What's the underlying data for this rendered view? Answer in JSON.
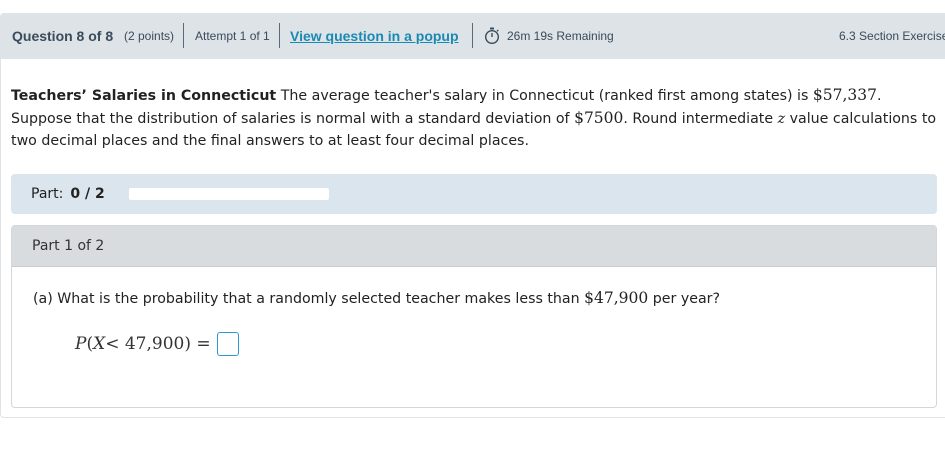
{
  "header": {
    "question": "Question 8 of 8",
    "points": "(2 points)",
    "attempt": "Attempt 1 of 1",
    "popup_link": "View question in a popup",
    "timer_icon": "stopwatch-icon",
    "remaining": "26m 19s Remaining",
    "section": "6.3 Section Exercise"
  },
  "problem": {
    "title": "Teachers’ Salaries in Connecticut",
    "text_1": "The average teacher's salary in Connecticut (ranked first among states) is",
    "mean": "$57,337",
    "text_2": ". Suppose that the distribution of salaries is normal with a standard deviation of",
    "sd": "$7500",
    "text_3": ". Round intermediate",
    "zvar": "z",
    "text_4": "value calculations to two decimal places and the final answers to at least four decimal places."
  },
  "progress": {
    "label": "Part:",
    "value": "0 / 2",
    "fraction": 0
  },
  "part": {
    "header": "Part 1 of 2",
    "question_prefix": "(a) What is the probability that a randomly selected teacher makes less than",
    "amount": "$47,900",
    "question_suffix": "per year?",
    "eq_p": "P",
    "eq_open": "(",
    "eq_var": "X",
    "eq_rel": "< 47,900) ="
  },
  "colors": {
    "header_bg": "#dde3e6",
    "link": "#1a8ab5",
    "progress_bar_bg": "#dae5ee",
    "answer_border": "#2b9ad1"
  }
}
